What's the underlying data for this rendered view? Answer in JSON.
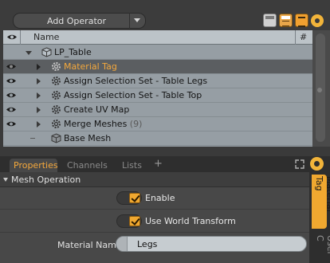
{
  "toolbar": {
    "add_operator_label": "Add Operator",
    "icons": [
      "list-view-icon",
      "table-view-icon",
      "columns-view-icon",
      "settings-icon"
    ]
  },
  "list": {
    "header": {
      "visibility_icon": "eye-icon",
      "name": "Name",
      "count": "#"
    },
    "items": [
      {
        "label": "LP_Table",
        "icon": "mesh-cube-icon",
        "expanded": true,
        "visible": false,
        "selected": false
      },
      {
        "label": "Material Tag",
        "icon": "gear-icon",
        "visible": true,
        "selected": true
      },
      {
        "label": "Assign Selection Set - Table Legs",
        "icon": "gear-icon",
        "visible": true,
        "selected": false
      },
      {
        "label": "Assign Selection Set - Table Top",
        "icon": "gear-icon",
        "visible": true,
        "selected": false
      },
      {
        "label": "Create UV Map",
        "icon": "gear-icon",
        "visible": true,
        "selected": false
      },
      {
        "label": "Merge Meshes",
        "count": "(9)",
        "icon": "gear-icon",
        "visible": true,
        "selected": false
      },
      {
        "label": "Base Mesh",
        "icon": "mesh-cube-icon",
        "visible": false,
        "selected": false
      }
    ]
  },
  "tabs": [
    {
      "label": "Properties",
      "active": true
    },
    {
      "label": "Channels",
      "active": false
    },
    {
      "label": "Lists",
      "active": false
    }
  ],
  "tab_add": "+",
  "properties": {
    "section": "Mesh Operation",
    "enable": {
      "label": "Enable",
      "checked": true
    },
    "world_transform": {
      "label": "Use World Transform",
      "checked": true
    },
    "material_name": {
      "label": "Material Name",
      "value": "Legs"
    }
  },
  "side_tabs": {
    "active": "Material Tag",
    "inactive": "User C"
  },
  "colors": {
    "accent": "#f0a830",
    "list_bg": "#969ea4",
    "selected_row": "#5b5e61"
  }
}
